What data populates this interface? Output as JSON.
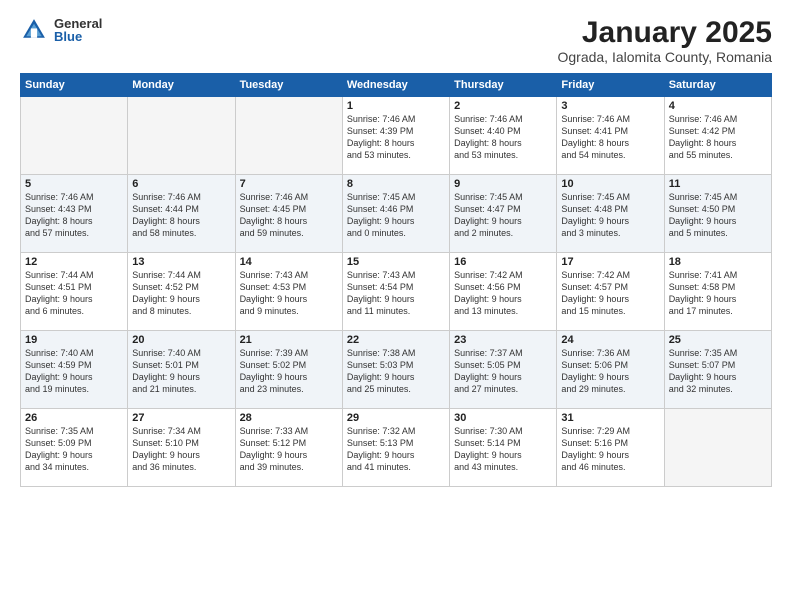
{
  "header": {
    "logo_general": "General",
    "logo_blue": "Blue",
    "title": "January 2025",
    "subtitle": "Ograda, Ialomita County, Romania"
  },
  "weekdays": [
    "Sunday",
    "Monday",
    "Tuesday",
    "Wednesday",
    "Thursday",
    "Friday",
    "Saturday"
  ],
  "weeks": [
    [
      {
        "day": "",
        "info": ""
      },
      {
        "day": "",
        "info": ""
      },
      {
        "day": "",
        "info": ""
      },
      {
        "day": "1",
        "info": "Sunrise: 7:46 AM\nSunset: 4:39 PM\nDaylight: 8 hours\nand 53 minutes."
      },
      {
        "day": "2",
        "info": "Sunrise: 7:46 AM\nSunset: 4:40 PM\nDaylight: 8 hours\nand 53 minutes."
      },
      {
        "day": "3",
        "info": "Sunrise: 7:46 AM\nSunset: 4:41 PM\nDaylight: 8 hours\nand 54 minutes."
      },
      {
        "day": "4",
        "info": "Sunrise: 7:46 AM\nSunset: 4:42 PM\nDaylight: 8 hours\nand 55 minutes."
      }
    ],
    [
      {
        "day": "5",
        "info": "Sunrise: 7:46 AM\nSunset: 4:43 PM\nDaylight: 8 hours\nand 57 minutes."
      },
      {
        "day": "6",
        "info": "Sunrise: 7:46 AM\nSunset: 4:44 PM\nDaylight: 8 hours\nand 58 minutes."
      },
      {
        "day": "7",
        "info": "Sunrise: 7:46 AM\nSunset: 4:45 PM\nDaylight: 8 hours\nand 59 minutes."
      },
      {
        "day": "8",
        "info": "Sunrise: 7:45 AM\nSunset: 4:46 PM\nDaylight: 9 hours\nand 0 minutes."
      },
      {
        "day": "9",
        "info": "Sunrise: 7:45 AM\nSunset: 4:47 PM\nDaylight: 9 hours\nand 2 minutes."
      },
      {
        "day": "10",
        "info": "Sunrise: 7:45 AM\nSunset: 4:48 PM\nDaylight: 9 hours\nand 3 minutes."
      },
      {
        "day": "11",
        "info": "Sunrise: 7:45 AM\nSunset: 4:50 PM\nDaylight: 9 hours\nand 5 minutes."
      }
    ],
    [
      {
        "day": "12",
        "info": "Sunrise: 7:44 AM\nSunset: 4:51 PM\nDaylight: 9 hours\nand 6 minutes."
      },
      {
        "day": "13",
        "info": "Sunrise: 7:44 AM\nSunset: 4:52 PM\nDaylight: 9 hours\nand 8 minutes."
      },
      {
        "day": "14",
        "info": "Sunrise: 7:43 AM\nSunset: 4:53 PM\nDaylight: 9 hours\nand 9 minutes."
      },
      {
        "day": "15",
        "info": "Sunrise: 7:43 AM\nSunset: 4:54 PM\nDaylight: 9 hours\nand 11 minutes."
      },
      {
        "day": "16",
        "info": "Sunrise: 7:42 AM\nSunset: 4:56 PM\nDaylight: 9 hours\nand 13 minutes."
      },
      {
        "day": "17",
        "info": "Sunrise: 7:42 AM\nSunset: 4:57 PM\nDaylight: 9 hours\nand 15 minutes."
      },
      {
        "day": "18",
        "info": "Sunrise: 7:41 AM\nSunset: 4:58 PM\nDaylight: 9 hours\nand 17 minutes."
      }
    ],
    [
      {
        "day": "19",
        "info": "Sunrise: 7:40 AM\nSunset: 4:59 PM\nDaylight: 9 hours\nand 19 minutes."
      },
      {
        "day": "20",
        "info": "Sunrise: 7:40 AM\nSunset: 5:01 PM\nDaylight: 9 hours\nand 21 minutes."
      },
      {
        "day": "21",
        "info": "Sunrise: 7:39 AM\nSunset: 5:02 PM\nDaylight: 9 hours\nand 23 minutes."
      },
      {
        "day": "22",
        "info": "Sunrise: 7:38 AM\nSunset: 5:03 PM\nDaylight: 9 hours\nand 25 minutes."
      },
      {
        "day": "23",
        "info": "Sunrise: 7:37 AM\nSunset: 5:05 PM\nDaylight: 9 hours\nand 27 minutes."
      },
      {
        "day": "24",
        "info": "Sunrise: 7:36 AM\nSunset: 5:06 PM\nDaylight: 9 hours\nand 29 minutes."
      },
      {
        "day": "25",
        "info": "Sunrise: 7:35 AM\nSunset: 5:07 PM\nDaylight: 9 hours\nand 32 minutes."
      }
    ],
    [
      {
        "day": "26",
        "info": "Sunrise: 7:35 AM\nSunset: 5:09 PM\nDaylight: 9 hours\nand 34 minutes."
      },
      {
        "day": "27",
        "info": "Sunrise: 7:34 AM\nSunset: 5:10 PM\nDaylight: 9 hours\nand 36 minutes."
      },
      {
        "day": "28",
        "info": "Sunrise: 7:33 AM\nSunset: 5:12 PM\nDaylight: 9 hours\nand 39 minutes."
      },
      {
        "day": "29",
        "info": "Sunrise: 7:32 AM\nSunset: 5:13 PM\nDaylight: 9 hours\nand 41 minutes."
      },
      {
        "day": "30",
        "info": "Sunrise: 7:30 AM\nSunset: 5:14 PM\nDaylight: 9 hours\nand 43 minutes."
      },
      {
        "day": "31",
        "info": "Sunrise: 7:29 AM\nSunset: 5:16 PM\nDaylight: 9 hours\nand 46 minutes."
      },
      {
        "day": "",
        "info": ""
      }
    ]
  ]
}
